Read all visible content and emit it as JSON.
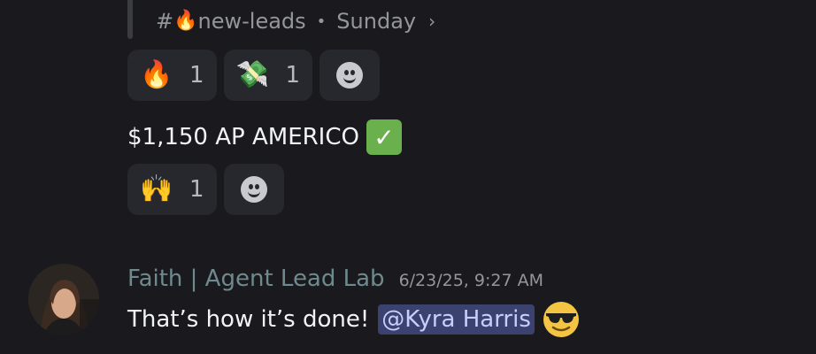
{
  "forwarded": {
    "channel_prefix": "#",
    "channel_name": "new-leads",
    "separator": "•",
    "day": "Sunday",
    "chevron": "›"
  },
  "reactions_row1": [
    {
      "emoji": "🔥",
      "icon": "fire-icon",
      "count": "1"
    },
    {
      "emoji": "💸",
      "icon": "money-with-wings-icon",
      "count": "1"
    }
  ],
  "message1": {
    "text": "$1,150 AP AMERICO",
    "check": "✓"
  },
  "reactions_row2": [
    {
      "emoji": "🙌",
      "icon": "raising-hands-icon",
      "count": "1"
    }
  ],
  "message2": {
    "author": "Faith | Agent Lead Lab",
    "timestamp": "6/23/25, 9:27 AM",
    "text": "That’s how it’s done!",
    "mention": "@Kyra Harris"
  },
  "colors": {
    "background": "#1a1a1e",
    "reaction_bg": "#27282d",
    "mention_bg": "#3c4270",
    "author": "#6e8a8e"
  }
}
